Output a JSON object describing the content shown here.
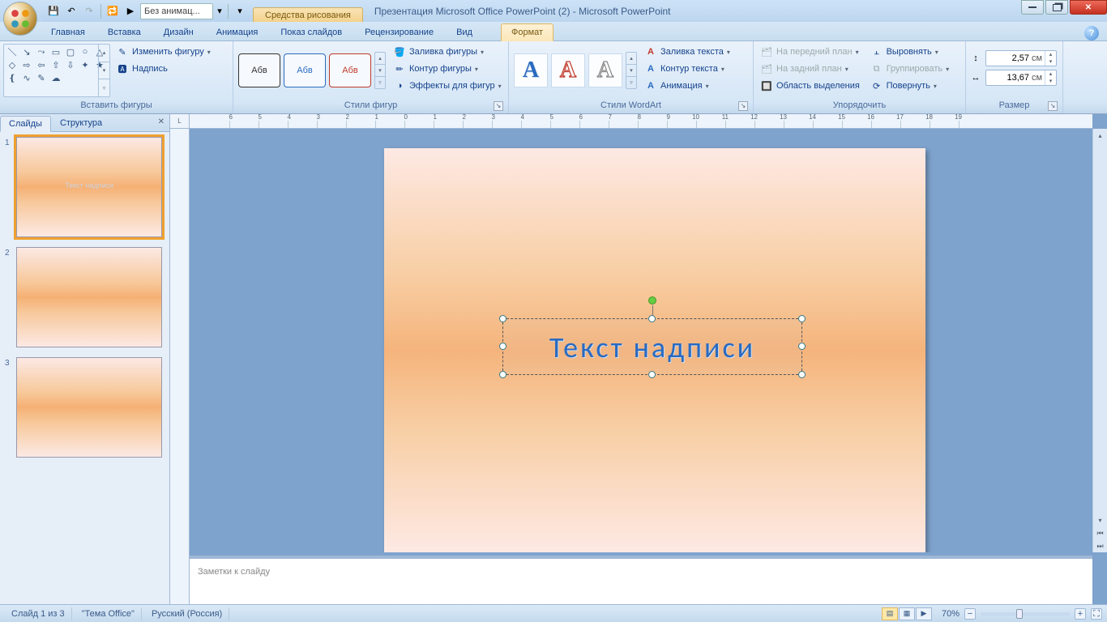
{
  "title_context_tab": "Средства рисования",
  "doc_title": "Презентация Microsoft Office PowerPoint (2) - Microsoft PowerPoint",
  "qat_anim": "Без анимац...",
  "tabs": {
    "home": "Главная",
    "insert": "Вставка",
    "design": "Дизайн",
    "animation": "Анимация",
    "slideshow": "Показ слайдов",
    "review": "Рецензирование",
    "view": "Вид",
    "format": "Формат"
  },
  "groups": {
    "insert_shapes": "Вставить фигуры",
    "shape_styles": "Стили фигур",
    "wordart_styles": "Стили WordArt",
    "arrange": "Упорядочить",
    "size": "Размер"
  },
  "btn": {
    "edit_shape": "Изменить фигуру",
    "text_box": "Надпись",
    "shape_fill": "Заливка фигуры",
    "shape_outline": "Контур фигуры",
    "shape_effects": "Эффекты для фигур",
    "text_fill": "Заливка текста",
    "text_outline": "Контур текста",
    "animation": "Анимация",
    "bring_front": "На передний план",
    "send_back": "На задний план",
    "selection_pane": "Область выделения",
    "align": "Выровнять",
    "group": "Группировать",
    "rotate": "Повернуть"
  },
  "style_sample": "Абв",
  "wordart_sample": "А",
  "size_h": "2,57",
  "size_w": "13,67",
  "size_unit": "см",
  "panel_tabs": {
    "slides": "Слайды",
    "outline": "Структура"
  },
  "thumb_text": "Текст надписи",
  "slide_text": "Текст надписи",
  "notes_placeholder": "Заметки к слайду",
  "status": {
    "slide_of": "Слайд 1 из 3",
    "theme": "\"Тема Office\"",
    "lang": "Русский (Россия)",
    "zoom": "70%"
  },
  "ruler_corner": "L"
}
